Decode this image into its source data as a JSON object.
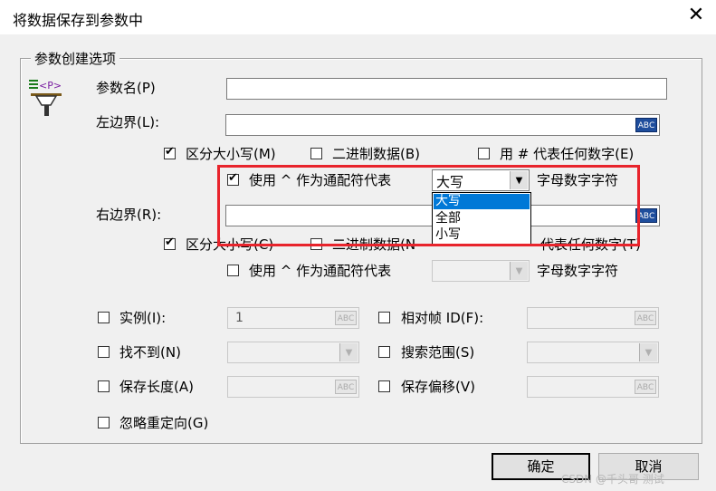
{
  "window": {
    "title": "将数据保存到参数中",
    "close_glyph": "✕"
  },
  "group": {
    "label": "参数创建选项"
  },
  "param_name": {
    "label": "参数名(P)",
    "value": ""
  },
  "left_boundary": {
    "label": "左边界(L):",
    "value": "",
    "case_sensitive": {
      "label": "区分大小写(M)",
      "checked": true
    },
    "binary": {
      "label": "二进制数据(B)",
      "checked": false
    },
    "hash_digit": {
      "label": "用 # 代表任何数字(E)",
      "checked": false
    },
    "wildcard": {
      "label": "使用 ^ 作为通配符代表",
      "checked": true,
      "combo_value": "大写",
      "suffix": "字母数字字符"
    }
  },
  "dropdown": {
    "options": [
      "大写",
      "全部",
      "小写"
    ],
    "selected": "大写"
  },
  "right_boundary": {
    "label": "右边界(R):",
    "value": "",
    "case_sensitive": {
      "label": "区分大小写(C)",
      "checked": true
    },
    "binary": {
      "label": "二进制数据(N",
      "checked": false
    },
    "hash_digit": {
      "label": "代表任何数字(T)",
      "checked": false
    },
    "wildcard": {
      "label": "使用 ^ 作为通配符代表",
      "checked": false,
      "combo_value": "",
      "suffix": "字母数字字符"
    }
  },
  "instance": {
    "label": "实例(I):",
    "checked": false,
    "value": "1"
  },
  "relative_frame": {
    "label": "相对帧 ID(F):",
    "checked": false,
    "value": ""
  },
  "not_found": {
    "label": "找不到(N)",
    "checked": false
  },
  "search_scope": {
    "label": "搜索范围(S)",
    "checked": false
  },
  "save_length": {
    "label": "保存长度(A)",
    "checked": false,
    "value": ""
  },
  "save_offset": {
    "label": "保存偏移(V)",
    "checked": false,
    "value": ""
  },
  "ignore_redirect": {
    "label": "忽略重定向(G)",
    "checked": false
  },
  "abc_badge": "ABC",
  "icon_text": "<P>",
  "buttons": {
    "ok": "确定",
    "cancel": "取消"
  },
  "watermark": "CSDN @千头哥 测试",
  "colors": {
    "highlight_box": "#e8242c",
    "selection": "#0078d7",
    "abc_badge": "#1e4d9c"
  }
}
